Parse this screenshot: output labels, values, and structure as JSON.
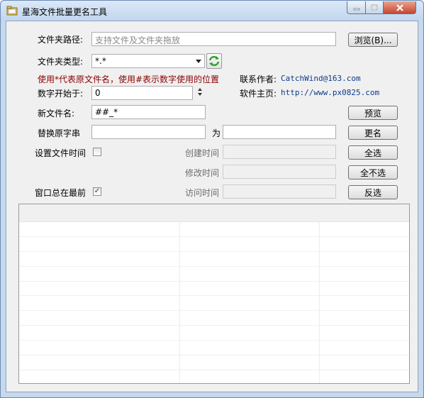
{
  "window": {
    "title": "星海文件批量更名工具"
  },
  "folder_path": {
    "label": "文件夹路径:",
    "placeholder": "支持文件及文件夹拖放",
    "browse_label": "浏览(B)..."
  },
  "file_type": {
    "label": "文件夹类型:",
    "value": "*.*",
    "refresh_icon": "refresh-icon"
  },
  "hint": "使用*代表原文件名，使用#表示数字使用的位置",
  "contact": {
    "label": "联系作者:",
    "value": "CatchWind@163.com"
  },
  "homepage": {
    "label": "软件主页:",
    "value": "http://www.px0825.com"
  },
  "number_start": {
    "label": "数字开始于:",
    "value": "0"
  },
  "new_name": {
    "label": "新文件名:",
    "value": "##_*"
  },
  "replace": {
    "label": "替换原字串",
    "to_label": "为",
    "from_value": "",
    "to_value": ""
  },
  "set_time": {
    "label": "设置文件时间",
    "checked": false
  },
  "created_time": {
    "label": "创建时间"
  },
  "modified_time": {
    "label": "修改时间"
  },
  "accessed_time": {
    "label": "访问时间"
  },
  "always_on_top": {
    "label": "窗口总在最前",
    "checked": true,
    "mark": "✓"
  },
  "buttons": {
    "preview": "预览",
    "rename": "更名",
    "select_all": "全选",
    "select_none": "全不选",
    "invert": "反选"
  },
  "colors": {
    "accent_red": "#8b0000",
    "link_blue": "#0b3a8c",
    "close_red": "#c7452b"
  }
}
